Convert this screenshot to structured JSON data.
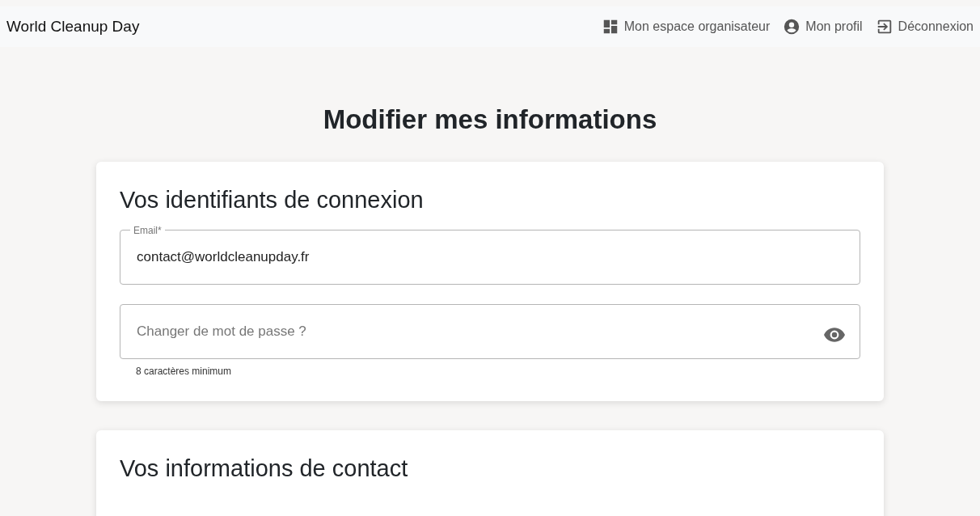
{
  "brand": "World Cleanup Day",
  "nav": [
    {
      "label": "Mon espace organisateur"
    },
    {
      "label": "Mon profil"
    },
    {
      "label": "Déconnexion"
    }
  ],
  "page_title": "Modifier mes informations",
  "sections": [
    {
      "title": "Vos identifiants de connexion",
      "fields": [
        {
          "kind": "text",
          "label": "Email*",
          "value": "contact@worldcleanupday.fr"
        },
        {
          "kind": "password",
          "placeholder": "Changer de mot de passe ?",
          "helper": "8 caractères minimum"
        }
      ]
    },
    {
      "title": "Vos informations de contact"
    }
  ]
}
